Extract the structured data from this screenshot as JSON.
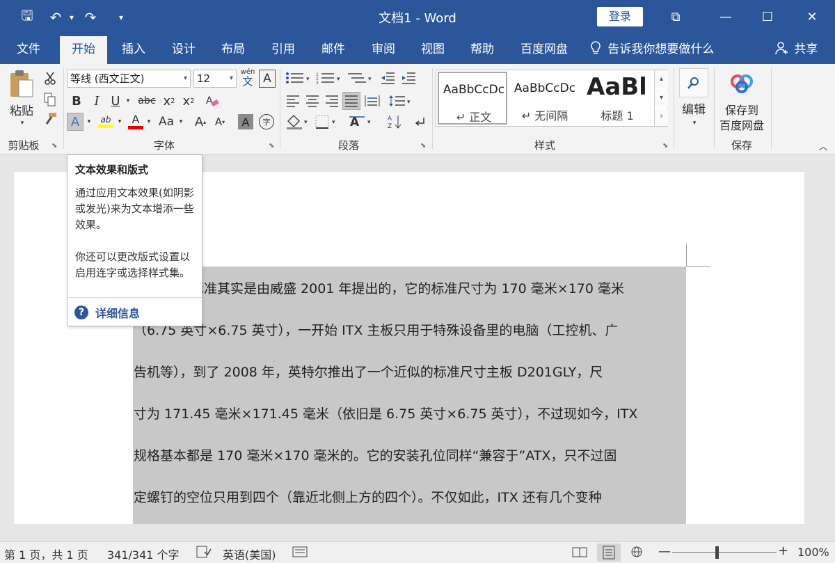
{
  "titlebar": {
    "doc_title": "文档1  -  Word",
    "login": "登录",
    "qat": {
      "save": "🖫",
      "undo": "↶",
      "undo_drop": "▾",
      "redo": "↷",
      "customize": "▾"
    },
    "window": {
      "ribbon_display": "⧉",
      "minimize": "—",
      "maximize": "☐",
      "close": "✕"
    }
  },
  "tabs": [
    "文件",
    "开始",
    "插入",
    "设计",
    "布局",
    "引用",
    "邮件",
    "审阅",
    "视图",
    "帮助",
    "百度网盘"
  ],
  "tell_me": "告诉我你想要做什么",
  "share": "共享",
  "ribbon": {
    "clipboard": {
      "paste": "粘贴",
      "group": "剪贴板"
    },
    "font": {
      "name": "等线 (西文正文)",
      "size": "12",
      "phonetic_top": "wén",
      "phonetic_char": "文",
      "char_border": "A",
      "bold": "B",
      "italic": "I",
      "underline": "U",
      "strike": "abc",
      "subscript_base": "x",
      "subscript_mark": "2",
      "superscript_base": "x",
      "superscript_mark": "2",
      "text_effects": "A",
      "highlight": "ab",
      "font_color": "A",
      "change_case": "Aa",
      "grow": "A",
      "shrink": "A",
      "char_shading": "A",
      "enclose": "字",
      "group": "字体"
    },
    "paragraph": {
      "group": "段落"
    },
    "styles": {
      "items": [
        {
          "preview": "AaBbCcDc",
          "name": "↵ 正文"
        },
        {
          "preview": "AaBbCcDc",
          "name": "↵ 无间隔"
        },
        {
          "preview": "AaBl",
          "name": "标题 1"
        }
      ],
      "group": "样式"
    },
    "editing": {
      "label": "编辑"
    },
    "save": {
      "label_1": "保存到",
      "label_2": "百度网盘",
      "group": "保存"
    }
  },
  "tooltip": {
    "title": "文本效果和版式",
    "body_1": "通过应用文本效果(如阴影或发光)来为文本增添一些效果。",
    "body_2": "你还可以更改版式设置以启用连字或选择样式集。",
    "help": "详细信息"
  },
  "document": {
    "lines": [
      "标准其实是由威盛 2001 年提出的，它的标准尺寸为 170 毫米×170 毫米",
      "（6.75 英寸×6.75 英寸），一开始 ITX 主板只用于特殊设备里的电脑（工控机、广",
      "告机等），到了 2008 年，英特尔推出了一个近似的标准尺寸主板 D201GLY，尺",
      "寸为 171.45 毫米×171.45 毫米（依旧是 6.75 英寸×6.75 英寸），不过现如今，ITX",
      "规格基本都是 170 毫米×170 毫米的。它的安装孔位同样“兼容于”ATX，只不过固",
      "定螺钉的空位只用到四个（靠近北侧上方的四个）。不仅如此，ITX 还有几个变种"
    ]
  },
  "statusbar": {
    "page": "第 1 页，共 1 页",
    "words": "341/341 个字",
    "language": "英语(美国)",
    "zoom": "100%"
  },
  "colors": {
    "accent": "#2b579a",
    "ribbon_bg": "#f3f3f3",
    "selection": "#c8c8c8"
  }
}
